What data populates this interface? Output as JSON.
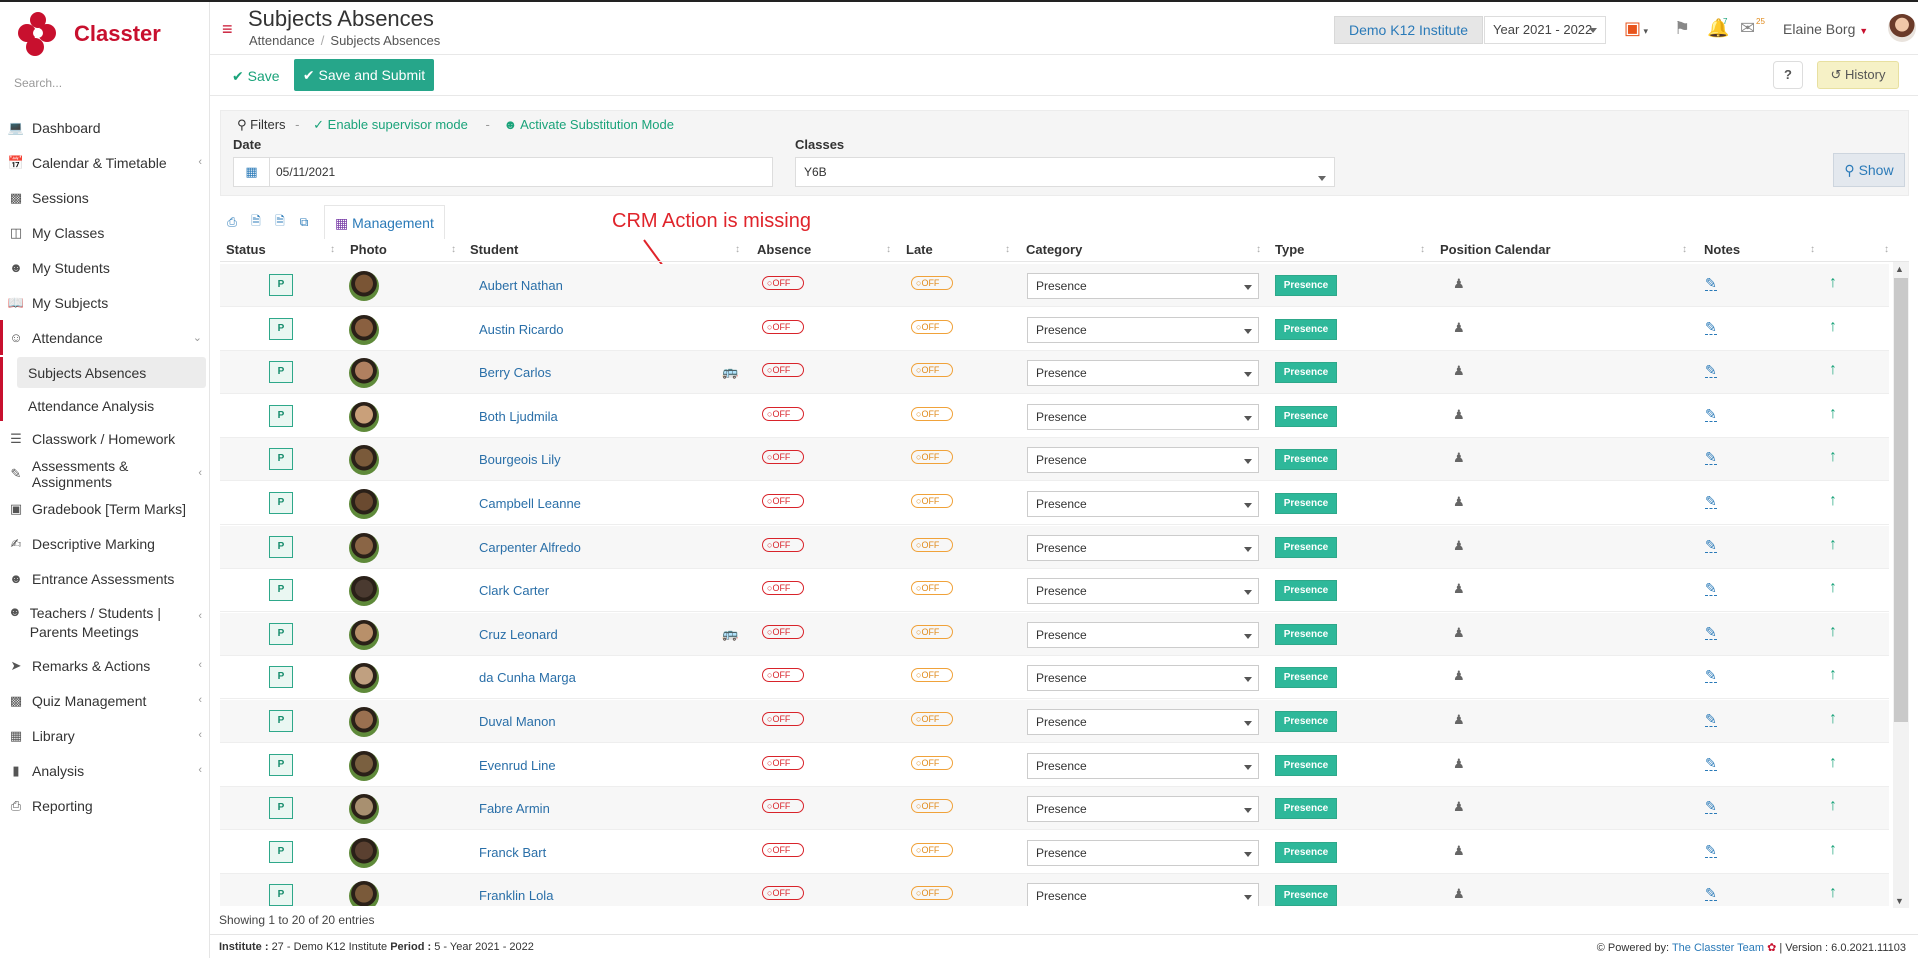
{
  "app": {
    "brand": "Classter"
  },
  "sidebar": {
    "search_placeholder": "Search...",
    "items": [
      {
        "label": "Dashboard",
        "icon": "laptop-icon"
      },
      {
        "label": "Calendar & Timetable",
        "icon": "calendar-icon",
        "chevron": true
      },
      {
        "label": "Sessions",
        "icon": "sessions-icon"
      },
      {
        "label": "My Classes",
        "icon": "classes-icon"
      },
      {
        "label": "My Students",
        "icon": "students-icon"
      },
      {
        "label": "My Subjects",
        "icon": "book-icon"
      },
      {
        "label": "Attendance",
        "icon": "attendance-icon",
        "chevron": true,
        "expanded": true
      },
      {
        "label": "Classwork / Homework",
        "icon": "list-icon"
      },
      {
        "label": "Assessments & Assignments",
        "icon": "edit-icon",
        "chevron": true
      },
      {
        "label": "Gradebook [Term Marks]",
        "icon": "gradebook-icon"
      },
      {
        "label": "Descriptive Marking",
        "icon": "marking-icon"
      },
      {
        "label": "Entrance Assessments",
        "icon": "user-check-icon"
      },
      {
        "label": "Teachers / Students | Parents Meetings",
        "icon": "meetings-icon",
        "chevron": true
      },
      {
        "label": "Remarks & Actions",
        "icon": "remarks-icon",
        "chevron": true
      },
      {
        "label": "Quiz Management",
        "icon": "quiz-icon",
        "chevron": true
      },
      {
        "label": "Library",
        "icon": "library-icon",
        "chevron": true
      },
      {
        "label": "Analysis",
        "icon": "chart-icon",
        "chevron": true
      },
      {
        "label": "Reporting",
        "icon": "print-icon"
      }
    ],
    "attendance_sub": [
      "Subjects Absences",
      "Attendance Analysis"
    ]
  },
  "header": {
    "title": "Subjects Absences",
    "breadcrumb": [
      "Attendance",
      "Subjects Absences"
    ],
    "institute": "Demo K12 Institute",
    "year": "Year 2021 - 2022",
    "notif_count": "7",
    "mail_count": "25",
    "user_name": "Elaine Borg"
  },
  "toolbar": {
    "save_label": "Save",
    "submit_label": "Save and Submit",
    "help_label": "?",
    "history_label": "History"
  },
  "filters": {
    "title": "Filters",
    "supervisor": "Enable supervisor mode",
    "substitution": "Activate Substitution Mode",
    "date_label": "Date",
    "date_value": "05/11/2021",
    "classes_label": "Classes",
    "classes_value": "Y6B",
    "show_label": "Show"
  },
  "table": {
    "management_label": "Management",
    "annotation": "CRM Action is missing",
    "columns": [
      "Status",
      "Photo",
      "Student",
      "Absence",
      "Late",
      "Category",
      "Type",
      "Position Calendar",
      "Notes"
    ],
    "rows": [
      {
        "status": "P",
        "name": "Aubert Nathan",
        "bus": false,
        "absence": "OFF",
        "late": "OFF",
        "category": "Presence",
        "type": "Presence",
        "skin": "#7a5535"
      },
      {
        "status": "P",
        "name": "Austin Ricardo",
        "bus": false,
        "absence": "OFF",
        "late": "OFF",
        "category": "Presence",
        "type": "Presence",
        "skin": "#8a6040"
      },
      {
        "status": "P",
        "name": "Berry Carlos",
        "bus": true,
        "absence": "OFF",
        "late": "OFF",
        "category": "Presence",
        "type": "Presence",
        "skin": "#b08060"
      },
      {
        "status": "P",
        "name": "Both Ljudmila",
        "bus": false,
        "absence": "OFF",
        "late": "OFF",
        "category": "Presence",
        "type": "Presence",
        "skin": "#c9a07a"
      },
      {
        "status": "P",
        "name": "Bourgeois Lily",
        "bus": false,
        "absence": "OFF",
        "late": "OFF",
        "category": "Presence",
        "type": "Presence",
        "skin": "#7a5a3a"
      },
      {
        "status": "P",
        "name": "Campbell Leanne",
        "bus": false,
        "absence": "OFF",
        "late": "OFF",
        "category": "Presence",
        "type": "Presence",
        "skin": "#6a4a30"
      },
      {
        "status": "P",
        "name": "Carpenter Alfredo",
        "bus": false,
        "absence": "OFF",
        "late": "OFF",
        "category": "Presence",
        "type": "Presence",
        "skin": "#8a6545"
      },
      {
        "status": "P",
        "name": "Clark Carter",
        "bus": false,
        "absence": "OFF",
        "late": "OFF",
        "category": "Presence",
        "type": "Presence",
        "skin": "#4a3a30"
      },
      {
        "status": "P",
        "name": "Cruz Leonard",
        "bus": true,
        "absence": "OFF",
        "late": "OFF",
        "category": "Presence",
        "type": "Presence",
        "skin": "#b8906a"
      },
      {
        "status": "P",
        "name": "da Cunha Marga",
        "bus": false,
        "absence": "OFF",
        "late": "OFF",
        "category": "Presence",
        "type": "Presence",
        "skin": "#c0a080"
      },
      {
        "status": "P",
        "name": "Duval Manon",
        "bus": false,
        "absence": "OFF",
        "late": "OFF",
        "category": "Presence",
        "type": "Presence",
        "skin": "#9a7050"
      },
      {
        "status": "P",
        "name": "Evenrud Line",
        "bus": false,
        "absence": "OFF",
        "late": "OFF",
        "category": "Presence",
        "type": "Presence",
        "skin": "#7a6040"
      },
      {
        "status": "P",
        "name": "Fabre Armin",
        "bus": false,
        "absence": "OFF",
        "late": "OFF",
        "category": "Presence",
        "type": "Presence",
        "skin": "#a89070"
      },
      {
        "status": "P",
        "name": "Franck Bart",
        "bus": false,
        "absence": "OFF",
        "late": "OFF",
        "category": "Presence",
        "type": "Presence",
        "skin": "#5a4030"
      },
      {
        "status": "P",
        "name": "Franklin Lola",
        "bus": false,
        "absence": "OFF",
        "late": "OFF",
        "category": "Presence",
        "type": "Presence",
        "skin": "#7a5a3a"
      }
    ],
    "showing": "Showing 1 to 20 of 20 entries"
  },
  "footer": {
    "institute_label": "Institute :",
    "institute_value": "27 - Demo K12 Institute",
    "period_label": "Period :",
    "period_value": "5 - Year 2021 - 2022",
    "powered": "Powered by:",
    "team": "The Classter Team",
    "version": "| Version : 6.0.2021.11103"
  },
  "colors": {
    "brand": "#c8102e",
    "accent": "#26a68a",
    "link": "#2a7ab8"
  }
}
